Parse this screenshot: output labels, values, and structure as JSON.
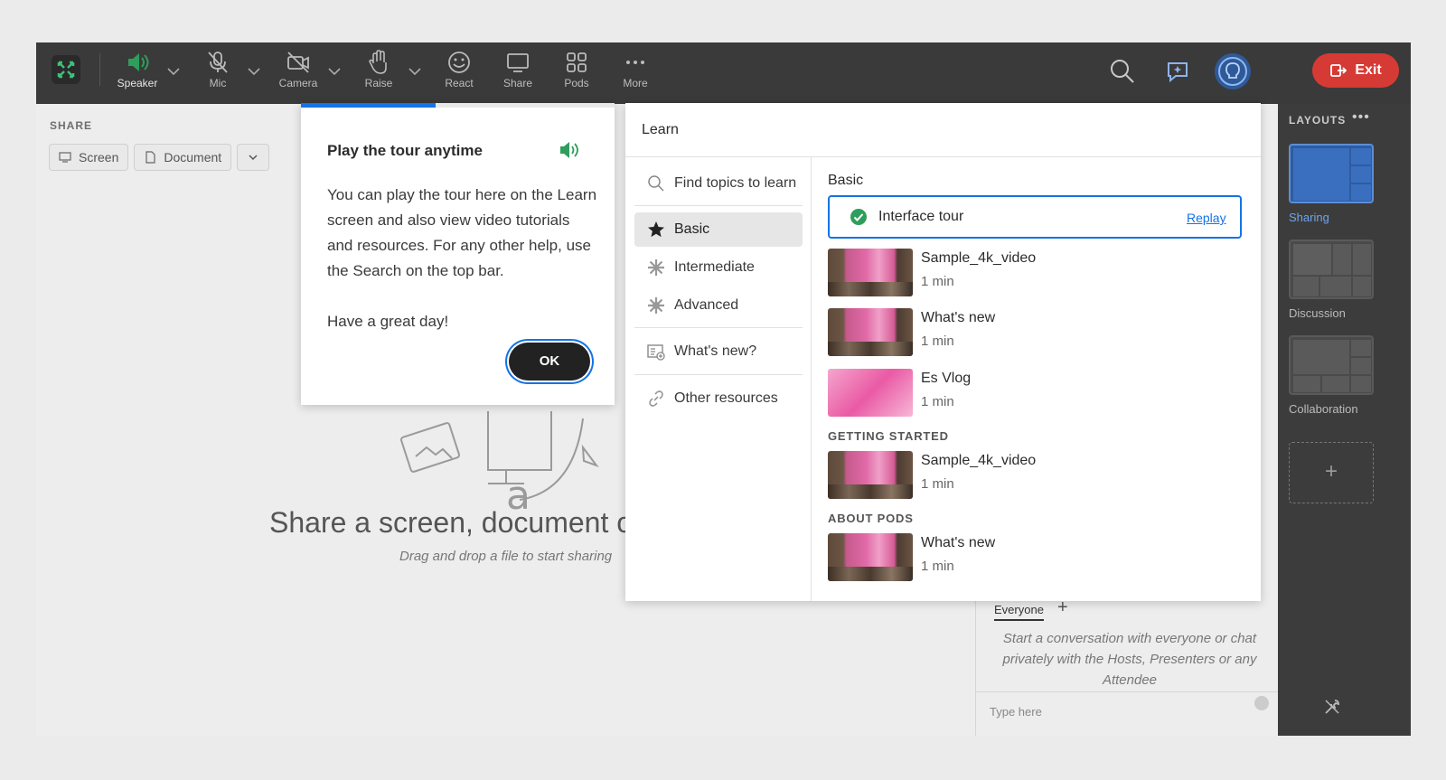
{
  "toolbar": {
    "items": [
      {
        "label": "Speaker",
        "icon": "speaker-icon"
      },
      {
        "label": "Mic",
        "icon": "mic-off-icon"
      },
      {
        "label": "Camera",
        "icon": "camera-off-icon"
      },
      {
        "label": "Raise",
        "icon": "hand-icon"
      },
      {
        "label": "React",
        "icon": "smiley-icon"
      },
      {
        "label": "Share",
        "icon": "monitor-icon"
      },
      {
        "label": "Pods",
        "icon": "grid-icon"
      },
      {
        "label": "More",
        "icon": "more-icon"
      }
    ],
    "exit_label": "Exit",
    "accent": "#2e9e5b",
    "exit_color": "#d63a35"
  },
  "share": {
    "title": "SHARE",
    "tabs": [
      "Screen",
      "Document"
    ],
    "headline": "Share a screen, document or w",
    "subtext": "Drag and drop a file to start sharing"
  },
  "chat": {
    "tab": "Everyone",
    "message": "Start a conversation with everyone or chat privately with the Hosts, Presenters or any Attendee",
    "input_placeholder": "Type here"
  },
  "layouts": {
    "title": "LAYOUTS",
    "items": [
      {
        "label": "Sharing",
        "selected": true
      },
      {
        "label": "Discussion",
        "selected": false
      },
      {
        "label": "Collaboration",
        "selected": false
      }
    ],
    "add": "+"
  },
  "tour": {
    "title": "Play the tour anytime",
    "body1": "You can play the tour here on the Learn screen and also view video tutorials and resources. For any other help, use the Search on the top bar.",
    "body2": "Have a great day!",
    "ok": "OK",
    "progress": 0.43
  },
  "learn": {
    "title": "Learn",
    "search_placeholder": "Find topics to learn",
    "nav": [
      {
        "label": "Basic",
        "icon": "star-filled-icon",
        "selected": true
      },
      {
        "label": "Intermediate",
        "icon": "star-burst-icon",
        "selected": false
      },
      {
        "label": "Advanced",
        "icon": "star-burst-icon",
        "selected": false
      },
      {
        "label": "What's new?",
        "icon": "news-icon",
        "selected": false
      },
      {
        "label": "Other resources",
        "icon": "link-icon",
        "selected": false
      }
    ],
    "section": "Basic",
    "tour_item": {
      "label": "Interface tour",
      "action": "Replay"
    },
    "basic_videos": [
      {
        "title": "Sample_4k_video",
        "duration": "1 min"
      },
      {
        "title": "What's new",
        "duration": "1 min"
      },
      {
        "title": "Es Vlog",
        "duration": "1 min"
      }
    ],
    "getting_started_title": "GETTING STARTED",
    "getting_started": [
      {
        "title": "Sample_4k_video",
        "duration": "1 min"
      }
    ],
    "about_pods_title": "ABOUT PODS",
    "about_pods": [
      {
        "title": "What's new",
        "duration": "1 min"
      }
    ]
  }
}
